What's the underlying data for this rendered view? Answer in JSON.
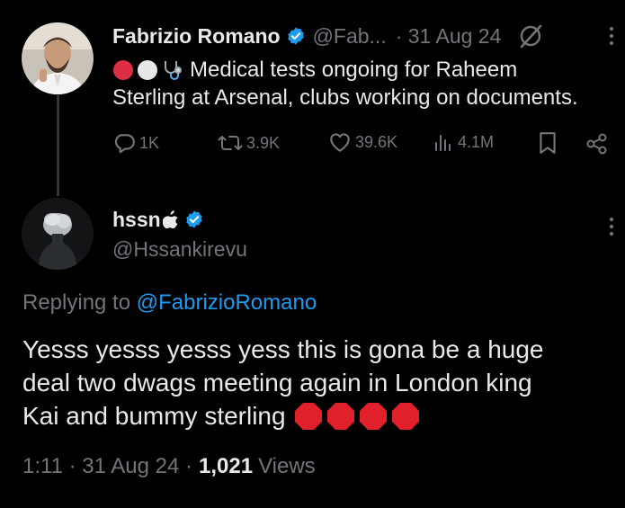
{
  "tweet": {
    "author_name": "Fabrizio Romano",
    "handle": "@Fab...",
    "date": "· 31 Aug 24",
    "text": "Medical tests ongoing for Raheem Sterling at Arsenal, clubs working on documents.",
    "text_line1": "Medical tests ongoing for Raheem",
    "text_line2": "Sterling at Arsenal, clubs working on documents.",
    "verified": true,
    "emojis": [
      "red-circle",
      "white-circle",
      "stethoscope"
    ],
    "actions": {
      "replies": "1K",
      "reposts": "3.9K",
      "likes": "39.6K",
      "views": "4.1M"
    }
  },
  "reply": {
    "author_name": "hssn",
    "handle": "@Hssankirevu",
    "verified": true,
    "replying_prefix": "Replying to ",
    "replying_to": "@FabrizioRomano",
    "text": "Yesss yesss yesss yess this is gona be a huge deal two dwags meeting again in London king Kai and bummy sterling",
    "text_line1": "Yesss yesss yesss yess this is gona be a huge",
    "text_line2": "deal two dwags meeting again in London king",
    "text_line3": "Kai and bummy sterling",
    "emoji_count": 4,
    "time": "1:11 · 31 Aug 24 ·",
    "views_count": "1,021",
    "views_label": "Views"
  },
  "colors": {
    "background": "#000000",
    "text": "#e7e9ea",
    "muted": "#71767b",
    "accent": "#1d9bf0",
    "stop_red": "#e0202a"
  }
}
